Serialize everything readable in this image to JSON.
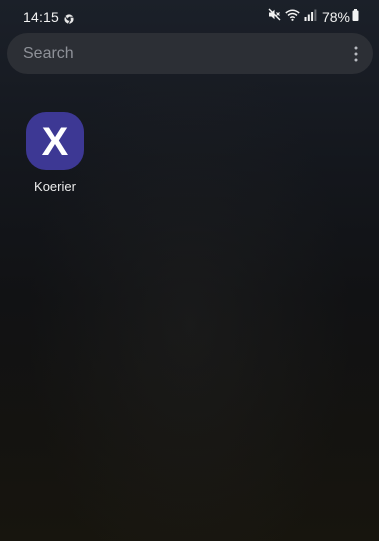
{
  "status_bar": {
    "time": "14:15",
    "battery_percent": "78%",
    "icons": [
      "chrome-notification-icon",
      "mute-icon",
      "wifi-icon",
      "signal-icon",
      "battery-icon"
    ]
  },
  "search": {
    "placeholder": "Search",
    "value": "",
    "menu_icon": "more-vert-icon"
  },
  "apps": [
    {
      "label": "Koerier",
      "icon_glyph": "X",
      "icon_color": "#3d3894"
    }
  ],
  "colors": {
    "search_bg": "#2c2f35",
    "app_icon_bg": "#3d3894"
  }
}
